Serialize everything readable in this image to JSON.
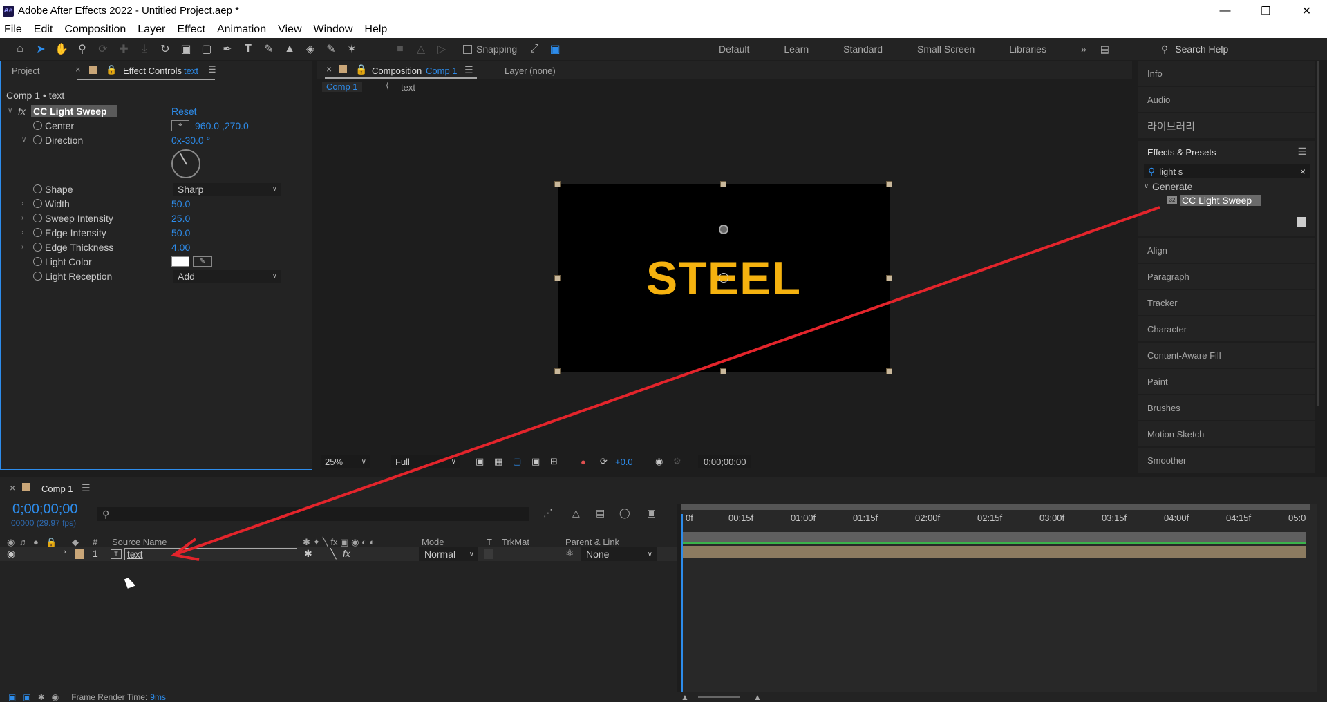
{
  "titlebar": {
    "app_icon": "Ae",
    "title": "Adobe After Effects 2022 - Untitled Project.aep *"
  },
  "menu": [
    "File",
    "Edit",
    "Composition",
    "Layer",
    "Effect",
    "Animation",
    "View",
    "Window",
    "Help"
  ],
  "toolbar": {
    "snapping_label": "Snapping",
    "workspaces": [
      "Default",
      "Learn",
      "Standard",
      "Small Screen",
      "Libraries"
    ],
    "search_help": "Search Help"
  },
  "effect_panel": {
    "tab_project": "Project",
    "tab_effect_controls": "Effect Controls",
    "tab_effect_layer": "text",
    "breadcrumb": "Comp 1 • text",
    "effect_name": "CC Light Sweep",
    "reset": "Reset",
    "params": {
      "center_label": "Center",
      "center_value": "960.0 ,270.0",
      "direction_label": "Direction",
      "direction_value": "0x-30.0 °",
      "shape_label": "Shape",
      "shape_value": "Sharp",
      "width_label": "Width",
      "width_value": "50.0",
      "sweep_label": "Sweep Intensity",
      "sweep_value": "25.0",
      "edge_int_label": "Edge Intensity",
      "edge_int_value": "50.0",
      "edge_thick_label": "Edge Thickness",
      "edge_thick_value": "4.00",
      "light_color_label": "Light Color",
      "light_color": "#ffffff",
      "light_reception_label": "Light Reception",
      "light_reception_value": "Add"
    }
  },
  "comp_panel": {
    "tab_label": "Composition",
    "tab_comp": "Comp 1",
    "layer_tab": "Layer (none)",
    "breadcrumb_comp": "Comp 1",
    "breadcrumb_layer": "text",
    "comp_text": "STEEL",
    "comp_text_color": "#f5b20f",
    "zoom": "25%",
    "resolution": "Full",
    "exposure": "+0.0",
    "timecode": "0;00;00;00"
  },
  "right_panel": {
    "info": "Info",
    "audio": "Audio",
    "libraries_kr": "라이브러리",
    "effects_presets": "Effects & Presets",
    "search_value": "light s",
    "generate": "Generate",
    "cc_light_sweep": "CC Light Sweep",
    "items": [
      "Align",
      "Paragraph",
      "Tracker",
      "Character",
      "Content-Aware Fill",
      "Paint",
      "Brushes",
      "Motion Sketch",
      "Smoother"
    ]
  },
  "timeline": {
    "tab": "Comp 1",
    "timecode": "0;00;00;00",
    "fps": "00000 (29.97 fps)",
    "col_hash": "#",
    "col_source": "Source Name",
    "col_mode": "Mode",
    "col_t": "T",
    "col_trkmat": "TrkMat",
    "col_parent": "Parent & Link",
    "layer_num": "1",
    "layer_name": "text",
    "layer_mode": "Normal",
    "layer_parent": "None",
    "ruler": [
      "0f",
      "00:15f",
      "01:00f",
      "01:15f",
      "02:00f",
      "02:15f",
      "03:00f",
      "03:15f",
      "04:00f",
      "04:15f",
      "05:0"
    ]
  },
  "status": {
    "render_label": "Frame Render Time:",
    "render_value": "9ms"
  }
}
